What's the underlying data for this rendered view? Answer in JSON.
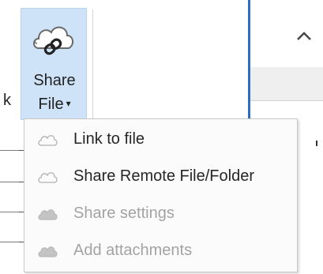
{
  "ribbon": {
    "clipped_label": "k",
    "share_button": {
      "line1": "Share",
      "line2": "File",
      "caret": "▾",
      "icon": "cloud-link-icon"
    },
    "collapse_icon": "chevron-up-icon"
  },
  "menu": {
    "items": [
      {
        "label": "Link to file",
        "icon": "cloud-outline-icon",
        "enabled": true
      },
      {
        "label": "Share Remote File/Folder",
        "icon": "cloud-outline-icon",
        "enabled": true
      },
      {
        "label": "Share settings",
        "icon": "cloud-filled-icon",
        "enabled": false
      },
      {
        "label": "Add attachments",
        "icon": "cloud-filled-icon",
        "enabled": false
      }
    ]
  },
  "colors": {
    "share_button_bg": "#cfe3f8",
    "separator_blue": "#2b6fc1",
    "enabled_text": "#262626",
    "disabled_text": "#a3a3a3"
  }
}
